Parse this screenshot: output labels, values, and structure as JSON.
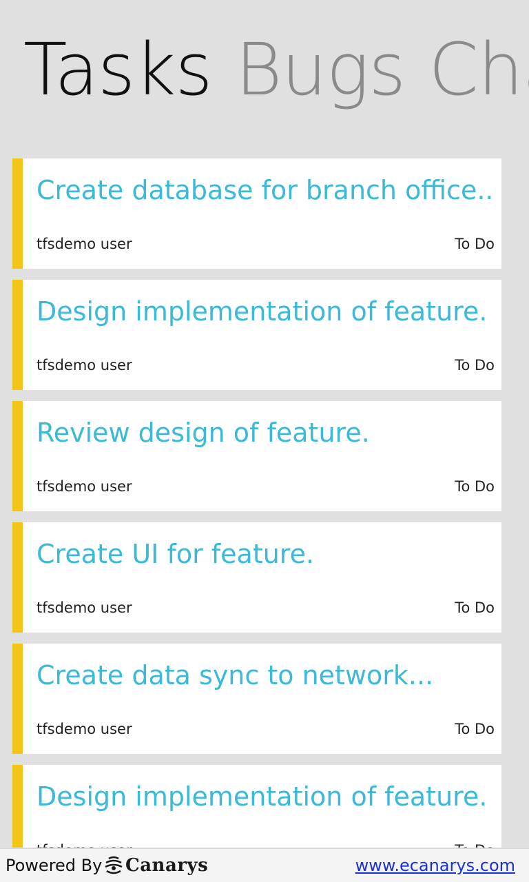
{
  "pivot": {
    "tabs": [
      {
        "label": "Tasks",
        "active": true
      },
      {
        "label": "Bugs",
        "active": false
      },
      {
        "label": "Cha",
        "active": false
      }
    ]
  },
  "tasks": [
    {
      "title": "Create database for branch office...",
      "owner": "tfsdemo user",
      "state": "To Do"
    },
    {
      "title": "Design implementation of feature.",
      "owner": "tfsdemo user",
      "state": "To Do"
    },
    {
      "title": "Review design of feature.",
      "owner": "tfsdemo user",
      "state": "To Do"
    },
    {
      "title": "Create UI for feature.",
      "owner": "tfsdemo user",
      "state": "To Do"
    },
    {
      "title": "Create data sync to network...",
      "owner": "tfsdemo user",
      "state": "To Do"
    },
    {
      "title": "Design implementation of feature.",
      "owner": "tfsdemo user",
      "state": "To Do"
    }
  ],
  "colors": {
    "accent_bar": "#f1c617",
    "title_text": "#3bb9d6",
    "background": "#e0e0e0",
    "link": "#1a32d6"
  },
  "footer": {
    "powered_label": "Powered By",
    "logo_text": "Canarys",
    "logo_icon": "canarys-logo-icon",
    "link_text": "www.ecanarys.com"
  }
}
